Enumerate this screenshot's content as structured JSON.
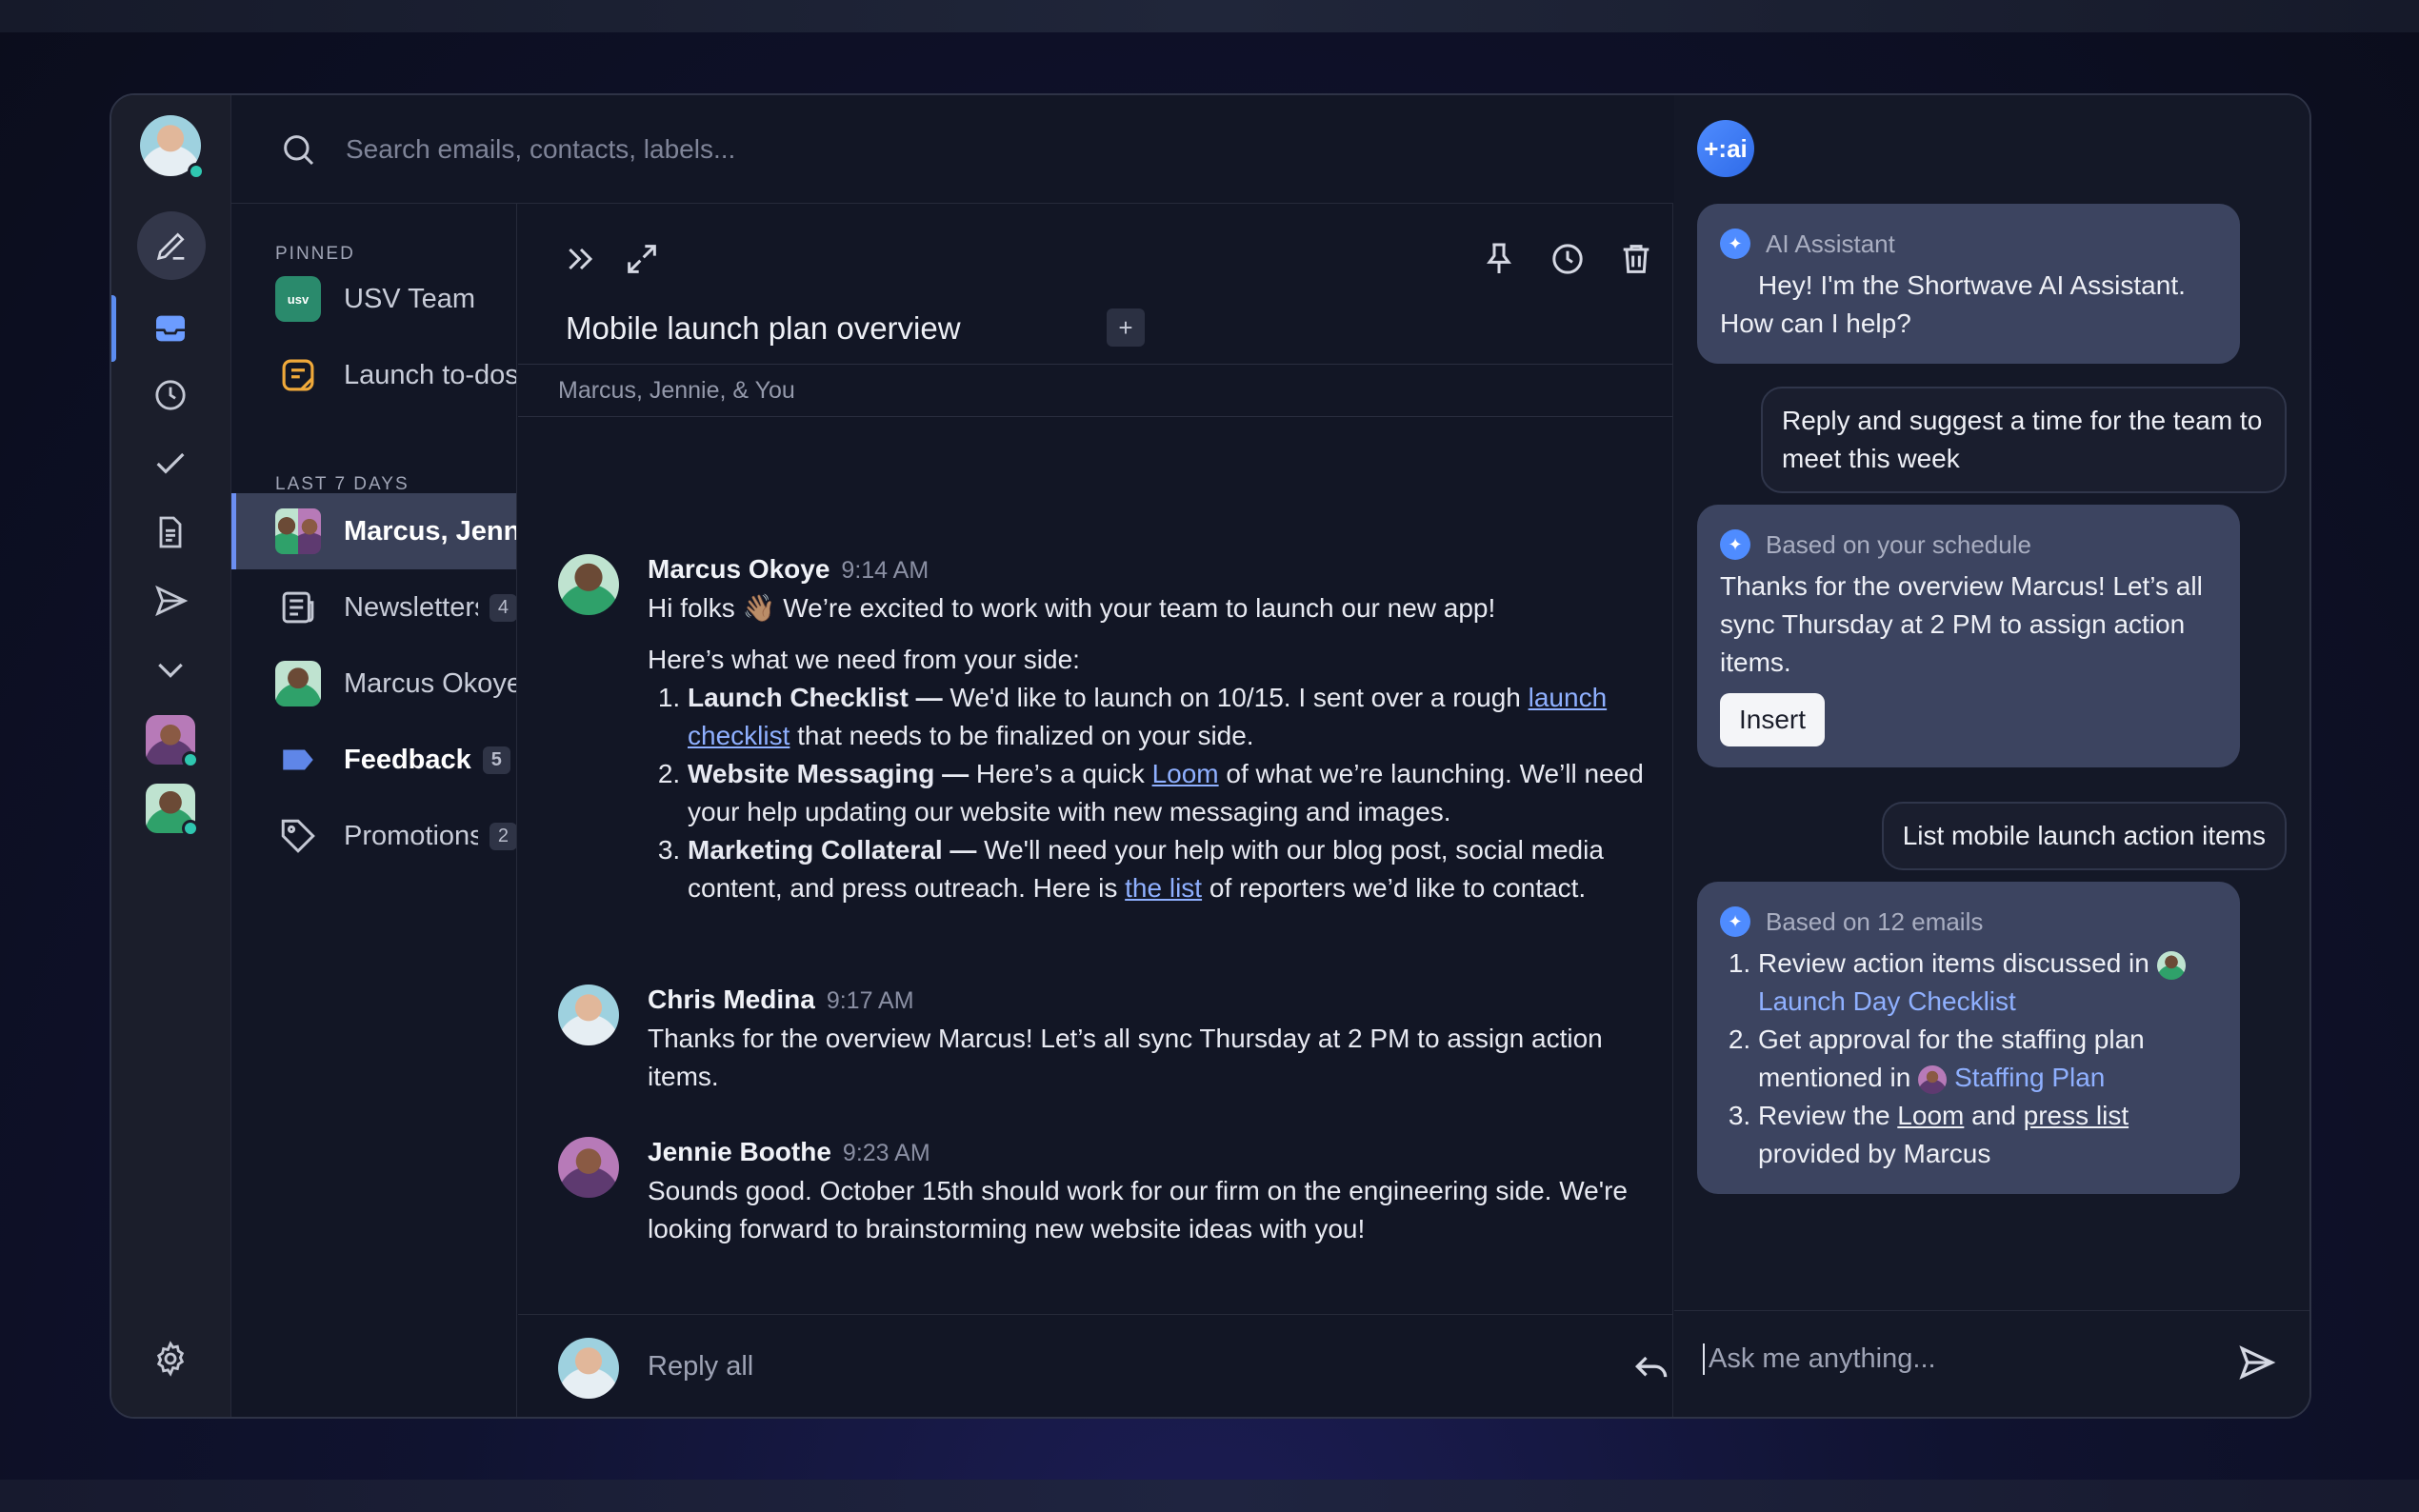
{
  "search": {
    "placeholder": "Search emails, contacts, labels..."
  },
  "nav": {
    "pinned_label": "PINNED",
    "last7_label": "LAST 7 DAYS",
    "pinned": [
      {
        "label": "USV Team",
        "icon": "usv-avatar",
        "icon_text": "usv"
      },
      {
        "label": "Launch to-dos",
        "icon": "note-icon"
      }
    ],
    "recent": [
      {
        "label": "Marcus, Jennie",
        "icon": "group-avatar",
        "active": true
      },
      {
        "label": "Newsletters",
        "icon": "newsletter-icon",
        "badge": "4"
      },
      {
        "label": "Marcus Okoye",
        "icon": "avatar"
      },
      {
        "label": "Feedback",
        "icon": "label-icon",
        "badge": "5",
        "bold": true
      },
      {
        "label": "Promotions",
        "icon": "tag-icon",
        "badge": "2"
      }
    ]
  },
  "thread": {
    "title": "Mobile launch plan overview",
    "plus": "+",
    "participants": "Marcus, Jennie, & You",
    "messages": [
      {
        "name": "Marcus Okoye",
        "time": "9:14 AM",
        "greeting": "Hi folks 👋🏽 We’re excited to work with your team to launch our new app!",
        "intro": "Here’s what we need from your side:",
        "items": [
          {
            "title": "Launch Checklist —",
            "text_before": " We'd like to launch on 10/15. I sent over a rough ",
            "link": "launch checklist",
            "text_after": " that needs to be finalized on your side."
          },
          {
            "title": "Website Messaging —",
            "text_before": " Here’s a quick ",
            "link": "Loom",
            "text_after": " of what we’re launching. We’ll need your help updating our website with new messaging and images."
          },
          {
            "title": "Marketing Collateral —",
            "text_before": " We'll need your help with our blog post, social media content, and press outreach. Here is ",
            "link": "the list",
            "text_after": " of reporters we’d like to contact."
          }
        ]
      },
      {
        "name": "Chris Medina",
        "time": "9:17 AM",
        "text": "Thanks for the overview Marcus! Let’s all sync Thursday at 2 PM to assign action items."
      },
      {
        "name": "Jennie Boothe",
        "time": "9:23 AM",
        "text": "Sounds good. October 15th should work for our firm on the engineering side. We're looking forward to brainstorming new website ideas with you!"
      }
    ],
    "reply_label": "Reply all"
  },
  "ai": {
    "logo": "+:ai",
    "bubbles": [
      {
        "header": "AI Assistant",
        "text": "Hey! I'm the Shortwave AI Assistant. How can I help?"
      },
      {
        "user": "Reply and suggest a time for the team to meet this week"
      },
      {
        "header": "Based on your schedule",
        "text": "Thanks for the overview Marcus! Let’s all sync Thursday at 2 PM to assign action items.",
        "button": "Insert"
      },
      {
        "user": "List mobile launch action items"
      },
      {
        "header": "Based on 12 emails",
        "items": [
          {
            "before": "Review action items discussed in ",
            "ref": "Launch Day Checklist"
          },
          {
            "before": "Get approval for the staffing plan mentioned in ",
            "ref": "Staffing Plan"
          },
          {
            "before": "Review the ",
            "link1": "Loom",
            "mid": " and ",
            "link2": "press list",
            "after": " provided by Marcus"
          }
        ]
      }
    ],
    "input_placeholder": "Ask me anything..."
  },
  "colors": {
    "accent": "#5b8cf0",
    "online": "#2fc7b0",
    "ai_bubble": "#3c4460",
    "link": "#8fb0ff"
  }
}
